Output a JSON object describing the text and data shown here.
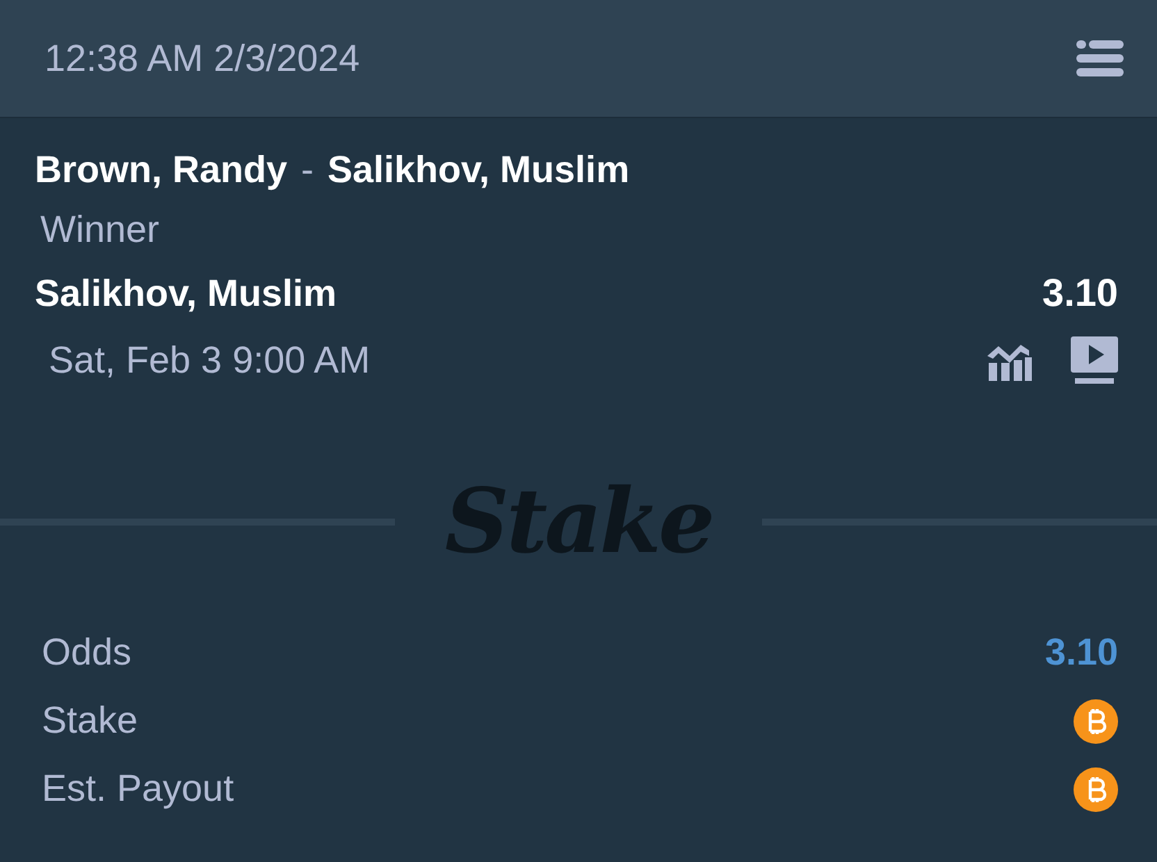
{
  "header": {
    "timestamp": "12:38 AM 2/3/2024"
  },
  "bet": {
    "home": "Brown, Randy",
    "separator": "-",
    "away": "Salikhov, Muslim",
    "market": "Winner",
    "selection": "Salikhov, Muslim",
    "odds": "3.10",
    "start": "Sat, Feb 3 9:00 AM"
  },
  "logo": "Stake",
  "summary": [
    {
      "label": "Odds",
      "kind": "value",
      "value": "3.10"
    },
    {
      "label": "Stake",
      "kind": "coin"
    },
    {
      "label": "Est. Payout",
      "kind": "coin"
    }
  ]
}
